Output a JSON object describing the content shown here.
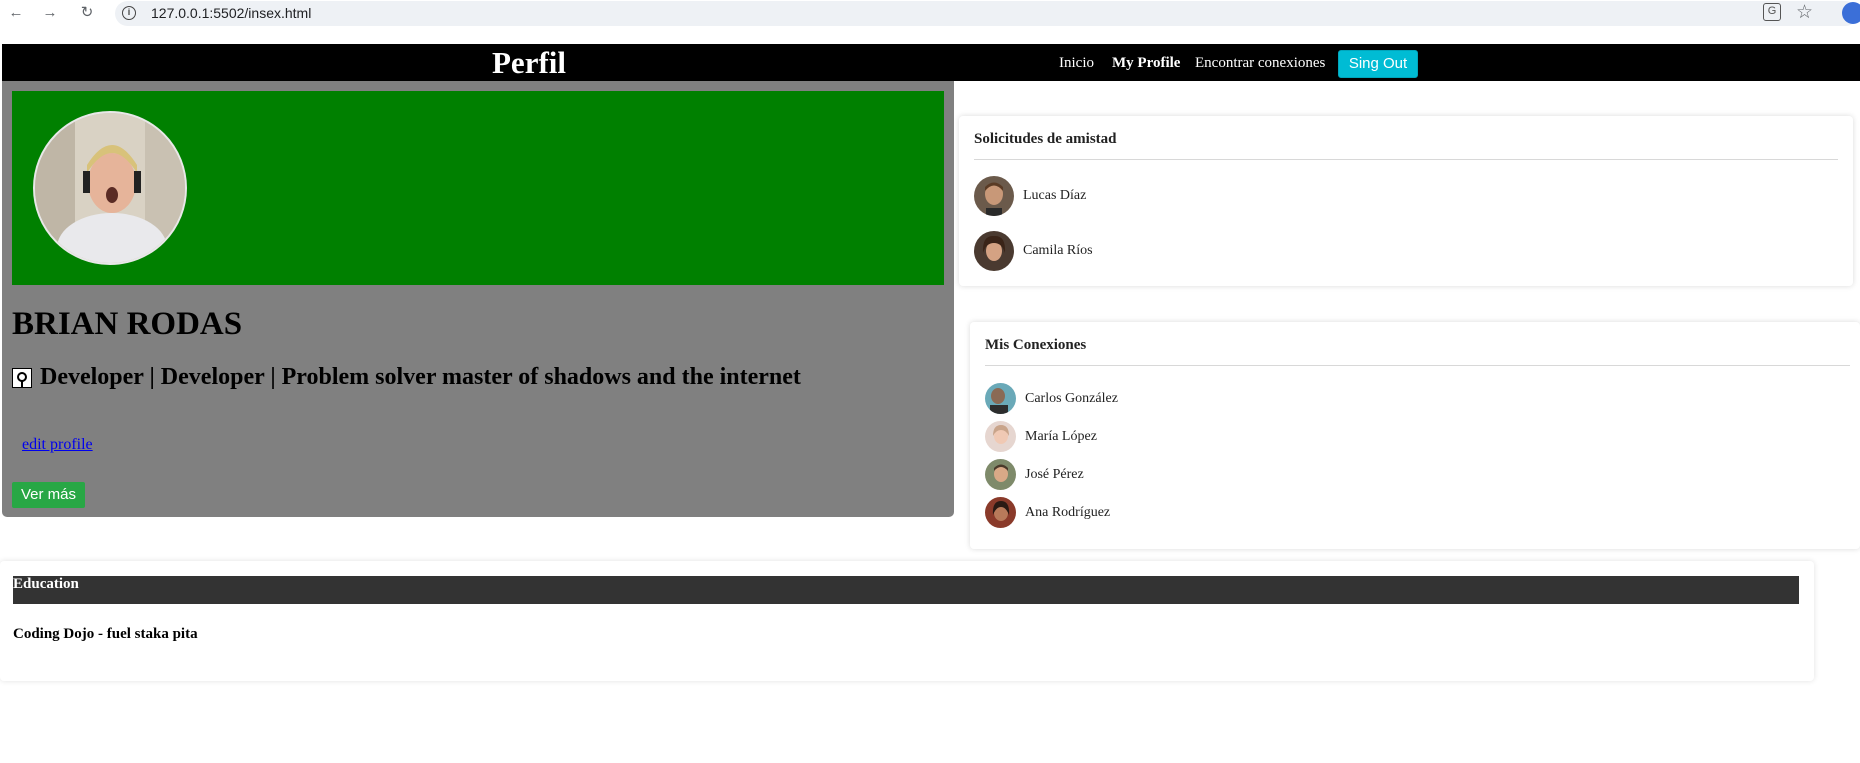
{
  "browser": {
    "url": "127.0.0.1:5502/insex.html",
    "back_icon": "←",
    "forward_icon": "→",
    "reload_icon": "↻",
    "info_icon": "i",
    "translate_icon": "G",
    "star_icon": "☆"
  },
  "navbar": {
    "brand": "Perfil",
    "links": [
      "Inicio",
      "My Profile",
      "Encontrar conexiones"
    ],
    "signout_label": "Sing Out",
    "accent": "#00bcd4"
  },
  "profile": {
    "name": "BRIAN RODAS",
    "headline": "Developer | Developer | Problem solver master of shadows and the internet",
    "edit_label": "edit profile",
    "more_label": "Ver más",
    "banner_color": "#008000",
    "card_color": "#808080"
  },
  "friend_requests": {
    "title": "Solicitudes de amistad",
    "items": [
      {
        "name": "Lucas Díaz"
      },
      {
        "name": "Camila Ríos"
      }
    ]
  },
  "connections": {
    "title": "Mis Conexiones",
    "items": [
      {
        "name": "Carlos González"
      },
      {
        "name": "María López"
      },
      {
        "name": "José Pérez"
      },
      {
        "name": "Ana Rodríguez"
      }
    ]
  },
  "education": {
    "title": "Education",
    "entries": [
      "Coding Dojo - fuel staka pita"
    ]
  }
}
